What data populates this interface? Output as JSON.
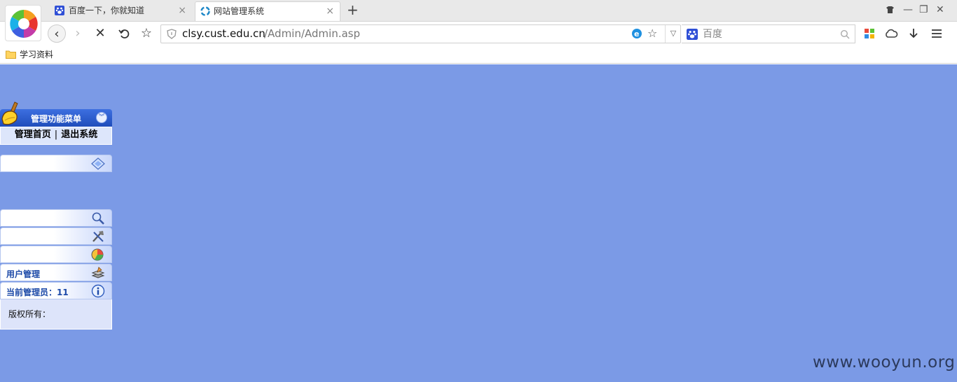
{
  "browser": {
    "tabs": [
      {
        "title": "百度一下，你就知道",
        "active": false
      },
      {
        "title": "网站管理系统",
        "active": true
      }
    ],
    "new_tab_label": "+",
    "address": {
      "host": "clsy.cust.edu.cn",
      "path": "/Admin/Admin.asp"
    },
    "search": {
      "placeholder": "百度"
    },
    "bookmark_folder": "学习资料"
  },
  "admin": {
    "menu_title": "管理功能菜单",
    "link_home": "管理首页",
    "link_separator": "|",
    "link_logout": "退出系统",
    "categories": [
      {
        "label": "",
        "icon": "diamond-icon"
      },
      {
        "label": "",
        "icon": "magnifier-icon"
      },
      {
        "label": "",
        "icon": "tools-icon"
      },
      {
        "label": "",
        "icon": "chart-icon"
      },
      {
        "label": "用户管理",
        "icon": "stack-icon"
      },
      {
        "label": "当前管理员：11",
        "icon": "info-icon"
      }
    ],
    "copyright": "版权所有："
  },
  "watermark": "www.wooyun.org",
  "colors": {
    "page_bg": "#7b9ae6",
    "menu_header": "#1f4dbb",
    "category_text": "#1d4aa8"
  }
}
